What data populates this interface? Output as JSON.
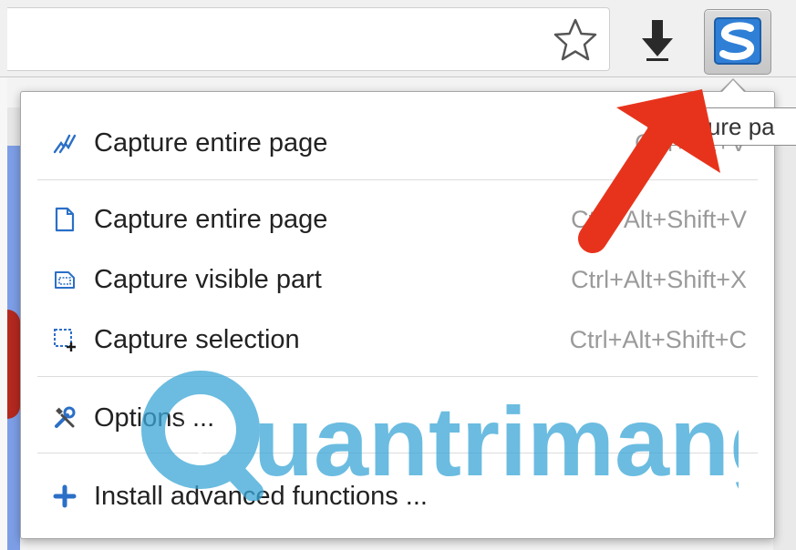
{
  "toolbar": {
    "star_icon": "star-outline-icon",
    "download_icon": "download-arrow-icon",
    "extension_logo": "S"
  },
  "tooltip": {
    "text": "Capture pa"
  },
  "menu": {
    "items": [
      {
        "label": "Capture entire page",
        "shortcut": "Ctrl+Alt+V",
        "icon": "scroll-capture-icon"
      },
      {
        "label": "Capture entire page",
        "shortcut": "Ctrl+Alt+Shift+V",
        "icon": "page-icon"
      },
      {
        "label": "Capture visible part",
        "shortcut": "Ctrl+Alt+Shift+X",
        "icon": "visible-area-icon"
      },
      {
        "label": "Capture selection",
        "shortcut": "Ctrl+Alt+Shift+C",
        "icon": "selection-icon"
      },
      {
        "label": "Options ...",
        "shortcut": "",
        "icon": "tools-icon"
      },
      {
        "label": "Install advanced functions ...",
        "shortcut": "",
        "icon": "plus-icon"
      }
    ]
  },
  "watermark": {
    "text": "uantrimang"
  },
  "colors": {
    "accent_blue": "#2b6fc7",
    "arrow_red": "#e8331c",
    "watermark_blue": "#3aa6d6"
  }
}
